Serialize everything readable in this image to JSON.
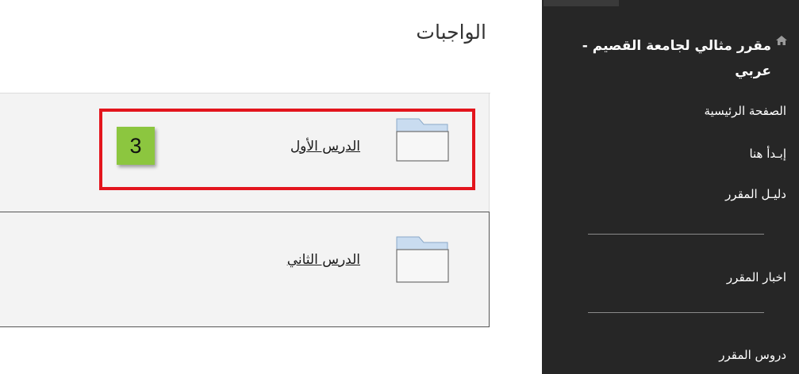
{
  "content": {
    "title": "الواجبات",
    "items": [
      {
        "label": "الدرس الأول",
        "icon": "folder-icon"
      },
      {
        "label": "الدرس الثاني",
        "icon": "folder-icon"
      }
    ],
    "step_badge": "3",
    "highlight_color": "#e3151d",
    "badge_color": "#8cc63f"
  },
  "sidebar": {
    "home_icon": "home-icon",
    "course_title": "مقرر مثالي لجامعة القصيم - عربي",
    "items": [
      {
        "label": "الصفحة الرئيسية"
      },
      {
        "label": "إبـدأ هنا"
      },
      {
        "label": "دليـل المقرر"
      },
      {
        "label": "اخبار المقرر"
      },
      {
        "label": "دروس المقرر"
      }
    ],
    "background": "#262626"
  }
}
